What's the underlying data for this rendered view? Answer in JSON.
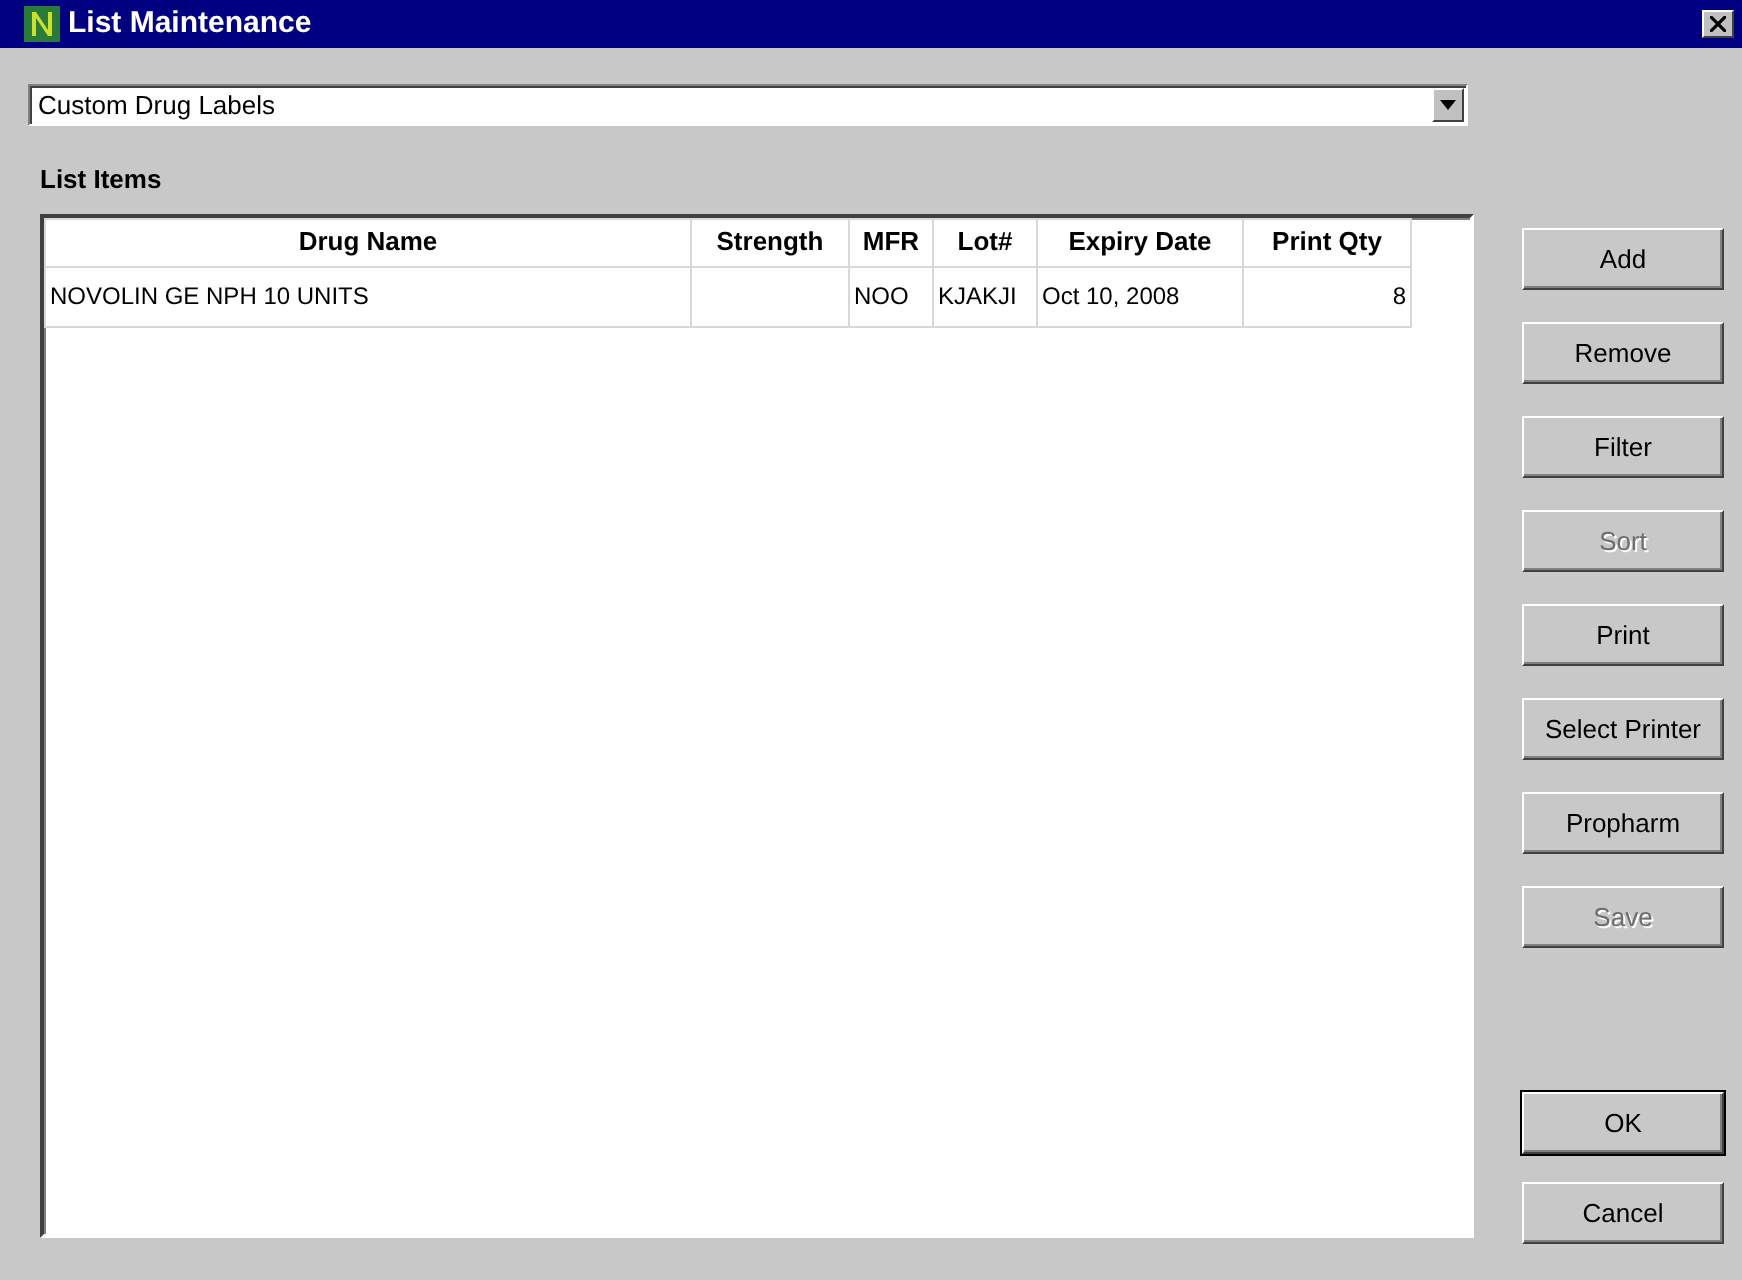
{
  "window": {
    "title": "List Maintenance"
  },
  "list_select": {
    "value": "Custom Drug Labels"
  },
  "section_label": "List Items",
  "table": {
    "columns": [
      "Drug Name",
      "Strength",
      "MFR",
      "Lot#",
      "Expiry Date",
      "Print Qty"
    ],
    "rows": [
      {
        "cells": [
          "NOVOLIN GE NPH 10 UNITS",
          "",
          "NOO",
          "KJAKJI",
          "Oct 10, 2008",
          "8"
        ],
        "selected": false
      }
    ]
  },
  "buttons": [
    {
      "label": "Add",
      "disabled": false
    },
    {
      "label": "Remove",
      "disabled": false
    },
    {
      "label": "Filter",
      "disabled": false
    },
    {
      "label": "Sort",
      "disabled": true
    },
    {
      "label": "Print",
      "disabled": false
    },
    {
      "label": "Select Printer",
      "disabled": false
    },
    {
      "label": "Propharm",
      "disabled": false
    },
    {
      "label": "Save",
      "disabled": true
    }
  ],
  "dialog_buttons": [
    {
      "label": "OK",
      "default": true
    },
    {
      "label": "Cancel",
      "default": false
    }
  ]
}
